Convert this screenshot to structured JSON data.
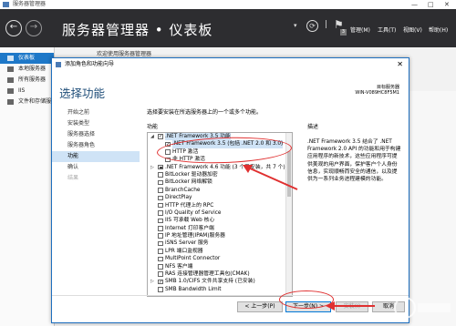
{
  "window": {
    "title": "服务器管理器",
    "controls": [
      "—",
      "□",
      "✕"
    ]
  },
  "header": {
    "title": "服务器管理器 • 仪表板",
    "back_icon": "back-arrow-icon",
    "forward_icon": "forward-arrow-icon",
    "refresh_symbol": "⟳",
    "flag_count": "3",
    "menus": [
      "管理(M)",
      "工具(T)",
      "视图(V)",
      "帮助(H)"
    ]
  },
  "sidebar": {
    "items": [
      {
        "label": "仪表板",
        "icon": "dashboard-icon",
        "selected": true
      },
      {
        "label": "本地服务器",
        "icon": "server-icon"
      },
      {
        "label": "所有服务器",
        "icon": "servers-icon"
      },
      {
        "label": "IIS",
        "icon": "iis-icon"
      },
      {
        "label": "文件和存储服务",
        "icon": "storage-icon"
      }
    ]
  },
  "background_text": "欢迎使用服务器管理器",
  "dialog": {
    "title": "添加角色和功能向导",
    "heading": "选择功能",
    "server_label": "目标服务器",
    "server_name": "WIN-V089HC8F5M1",
    "steps": [
      {
        "label": "开始之前",
        "state": "normal"
      },
      {
        "label": "安装类型",
        "state": "normal"
      },
      {
        "label": "服务器选择",
        "state": "normal"
      },
      {
        "label": "服务器角色",
        "state": "normal"
      },
      {
        "label": "功能",
        "state": "active"
      },
      {
        "label": "确认",
        "state": "normal"
      },
      {
        "label": "结果",
        "state": "disabled"
      }
    ],
    "instruction": "选择要安装在所选服务器上的一个或多个功能。",
    "features_label": "功能",
    "description_label": "描述",
    "features": [
      {
        "label": ".NET Framework 3.5 功能",
        "indent": 0,
        "expander": "◢",
        "check": "checked",
        "highlight": true
      },
      {
        "label": ".NET Framework 3.5 (包括 .NET 2.0 和 3.0)",
        "indent": 1,
        "expander": "",
        "check": "checked",
        "highlight": true
      },
      {
        "label": "HTTP 激活",
        "indent": 1,
        "expander": "",
        "check": "none"
      },
      {
        "label": "非 HTTP 激活",
        "indent": 1,
        "expander": "",
        "check": "none"
      },
      {
        "label": ".NET Framework 4.6 功能 (3 个已安装，共 7 个)",
        "indent": 0,
        "expander": "▷",
        "check": "partial"
      },
      {
        "label": "BitLocker 驱动器加密",
        "indent": 0,
        "expander": "",
        "check": "none"
      },
      {
        "label": "BitLocker 网络解锁",
        "indent": 0,
        "expander": "",
        "check": "none"
      },
      {
        "label": "BranchCache",
        "indent": 0,
        "expander": "",
        "check": "none"
      },
      {
        "label": "DirectPlay",
        "indent": 0,
        "expander": "",
        "check": "none"
      },
      {
        "label": "HTTP 代理上的 RPC",
        "indent": 0,
        "expander": "",
        "check": "none"
      },
      {
        "label": "I/O Quality of Service",
        "indent": 0,
        "expander": "",
        "check": "none"
      },
      {
        "label": "IIS 可承载 Web 核心",
        "indent": 0,
        "expander": "",
        "check": "none"
      },
      {
        "label": "Internet 打印客户端",
        "indent": 0,
        "expander": "",
        "check": "none"
      },
      {
        "label": "IP 地址管理(IPAM)服务器",
        "indent": 0,
        "expander": "",
        "check": "none"
      },
      {
        "label": "iSNS Server 服务",
        "indent": 0,
        "expander": "",
        "check": "none"
      },
      {
        "label": "LPR 端口监视器",
        "indent": 0,
        "expander": "",
        "check": "none"
      },
      {
        "label": "MultiPoint Connector",
        "indent": 0,
        "expander": "",
        "check": "none"
      },
      {
        "label": "NFS 客户端",
        "indent": 0,
        "expander": "",
        "check": "none"
      },
      {
        "label": "RAS 连接管理器管理工具包(CMAK)",
        "indent": 0,
        "expander": "",
        "check": "none"
      },
      {
        "label": "SMB 1.0/CIFS 文件共享支持 (已安装)",
        "indent": 0,
        "expander": "▷",
        "check": "checked"
      },
      {
        "label": "SMB Bandwidth Limit",
        "indent": 0,
        "expander": "",
        "check": "none"
      }
    ],
    "description": ".NET Framework 3.5 结合了 .NET Framework 2.0 API 的功能和用于构建应用程序的新技术，这些应用程序可提供美观的用户界面，保护客户个人身份信息，实现顺畅而安全的通信，以及提供为一系列业务进程建模的功能。",
    "buttons": {
      "prev": "< 上一步(P)",
      "next": "下一步(N) >",
      "install": "安装(I)",
      "cancel": "取消"
    }
  },
  "colors": {
    "accent": "#1e78c8",
    "title": "#1f4e79",
    "annotation": "#e03030",
    "header": "#2d2d30"
  }
}
